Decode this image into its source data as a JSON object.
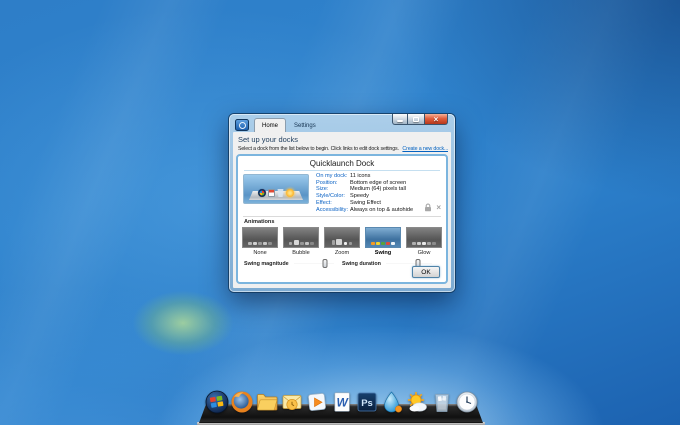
{
  "window": {
    "controls": [
      "minimize",
      "maximize",
      "close"
    ],
    "logo": "objectdock",
    "tabs": [
      {
        "label": "Home",
        "active": true
      },
      {
        "label": "Settings",
        "active": false
      }
    ],
    "heading": "Set up your docks",
    "instruction": "Select a dock from the list below to begin. Click links to edit dock settings.",
    "create_link": "Create a new dock...",
    "panel": {
      "title": "Quicklaunch Dock",
      "details": [
        {
          "label": "On my dock:",
          "value": "11 icons"
        },
        {
          "label": "Position:",
          "value": "Bottom edge of screen"
        },
        {
          "label": "Size:",
          "value": "Medium (64) pixels tall"
        },
        {
          "label": "Style/Color:",
          "value": "Speedy"
        },
        {
          "label": "Effect:",
          "value": "Swing Effect"
        },
        {
          "label": "Accessibility:",
          "value": "Always on top & autohide"
        }
      ],
      "tool_icons": [
        "lock-icon",
        "delete-icon"
      ],
      "animations": {
        "label": "Animations",
        "options": [
          {
            "label": "None",
            "selected": false
          },
          {
            "label": "Bubble",
            "selected": false
          },
          {
            "label": "Zoom",
            "selected": false
          },
          {
            "label": "Swing",
            "selected": true
          },
          {
            "label": "Glow",
            "selected": false
          }
        ]
      },
      "sliders": [
        {
          "label": "Swing magnitude",
          "value_pct": 78
        },
        {
          "label": "Swing duration",
          "value_pct": 70
        }
      ],
      "ok_label": "OK"
    }
  },
  "preview": {
    "icon_names": [
      "windows-icon",
      "calendar-icon",
      "recycle-bin-icon",
      "sun-icon"
    ]
  },
  "dock": {
    "icon_names": [
      "windows-icon",
      "firefox-icon",
      "folder-icon",
      "outlook-icon",
      "media-player-icon",
      "word-icon",
      "photoshop-icon",
      "water-drop-icon",
      "weather-icon",
      "recycle-bin-icon",
      "clock-icon"
    ]
  },
  "colors": {
    "desktop_blue": "#2b7ec9",
    "link_blue": "#0563c1",
    "panel_border": "#7cb5de",
    "selected_thumb_blue": "#3e719f",
    "close_button_red": "#c5431f"
  }
}
